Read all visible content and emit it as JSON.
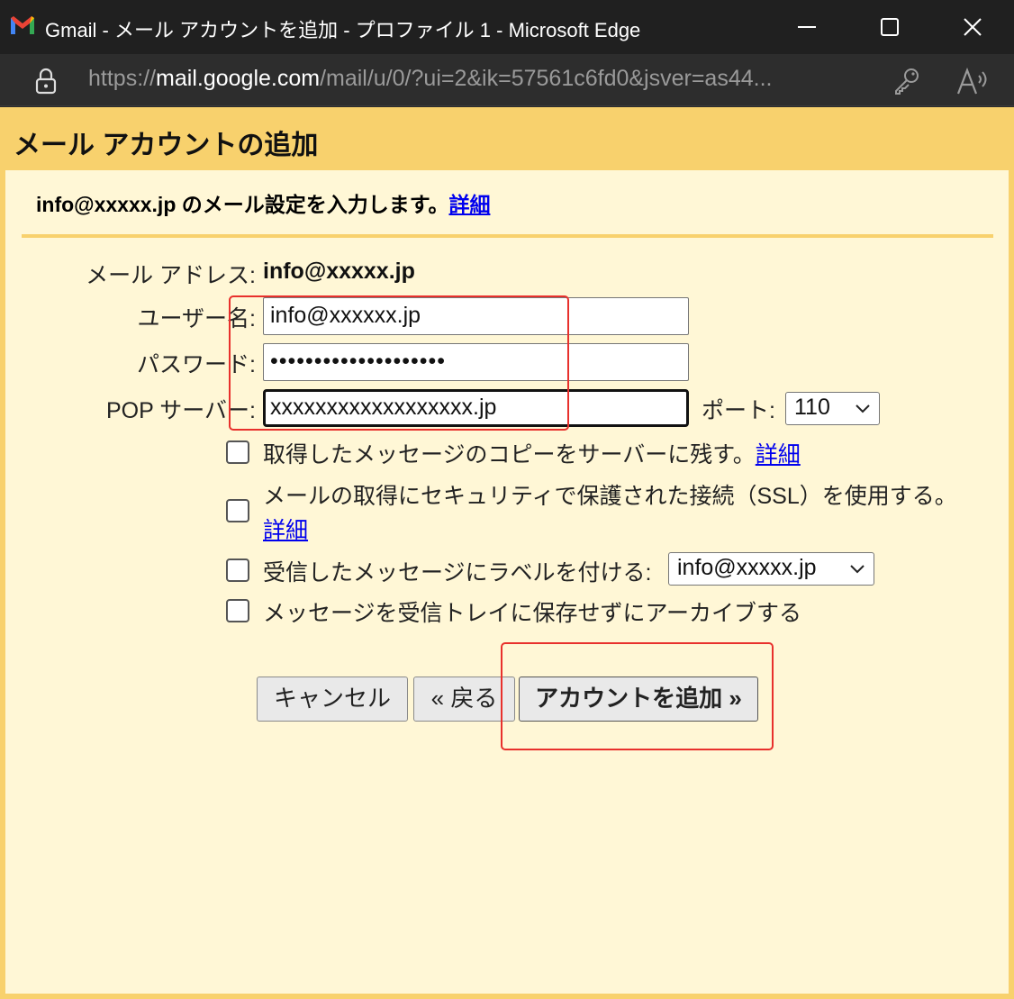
{
  "window": {
    "title": "Gmail - メール アカウントを追加 - プロファイル 1 - Microsoft Edge",
    "icons": [
      "gmail-icon",
      "minimize-icon",
      "maximize-icon",
      "close-icon"
    ]
  },
  "addressbar": {
    "url_prefix": "https://",
    "url_host": "mail.google.com",
    "url_path": "/mail/u/0/?ui=2&ik=57561c6fd0&jsver=as44...",
    "icons": [
      "lock-icon",
      "key-icon",
      "read-aloud-icon"
    ]
  },
  "dialog": {
    "title": "メール アカウントの追加",
    "intro_text": "info@xxxxx.jp のメール設定を入力します。",
    "intro_link": "詳細",
    "email_label": "メール アドレス:",
    "email_value": "info@xxxxx.jp",
    "username_label": "ユーザー名:",
    "username_value": "info@xxxxxx.jp",
    "password_label": "パスワード:",
    "password_value": "••••••••••••••••••••",
    "pop_label": "POP サーバー:",
    "pop_value": "xxxxxxxxxxxxxxxxxx.jp",
    "port_label": "ポート:",
    "port_value": "110",
    "options": [
      {
        "text": "取得したメッセージのコピーをサーバーに残す。",
        "link": "詳細",
        "checked": false
      },
      {
        "text": "メールの取得にセキュリティで保護された接続（SSL）を使用する。",
        "link": "詳細",
        "checked": false
      },
      {
        "text": "受信したメッセージにラベルを付ける:",
        "select_value": "info@xxxxx.jp",
        "checked": false
      },
      {
        "text": "メッセージを受信トレイに保存せずにアーカイブする",
        "checked": false
      }
    ],
    "buttons": {
      "cancel": "キャンセル",
      "back": "« 戻る",
      "add": "アカウントを追加 »"
    }
  },
  "colors": {
    "header": "#f8d16d",
    "dialog_bg": "#fff7d6",
    "annotation": "#e8302c",
    "link": "#0000ee"
  }
}
